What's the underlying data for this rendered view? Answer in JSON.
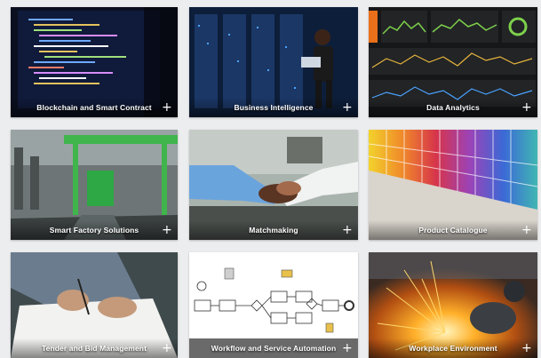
{
  "tiles": [
    {
      "title": "Blockchain and Smart Contract"
    },
    {
      "title": "Business Intelligence"
    },
    {
      "title": "Data Analytics"
    },
    {
      "title": "Smart Factory Solutions"
    },
    {
      "title": "Matchmaking"
    },
    {
      "title": "Product Catalogue"
    },
    {
      "title": "Tender and Bid Management"
    },
    {
      "title": "Workflow and Service Automation"
    },
    {
      "title": "Workplace Environment"
    }
  ],
  "icons": {
    "expand": "plus-icon"
  },
  "colors": {
    "caption_text": "#ffffff",
    "page_bg": "#ecedef"
  }
}
